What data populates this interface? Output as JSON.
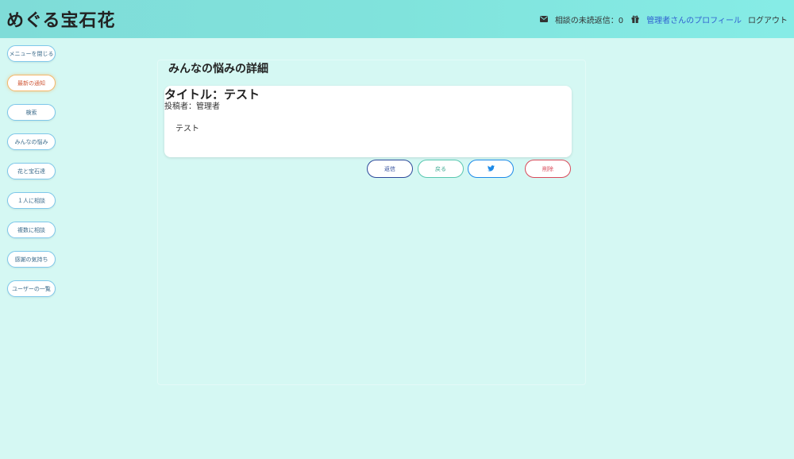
{
  "header": {
    "brand": "めぐる宝石花",
    "unread_label": "相談の未読返信：0",
    "profile_label": "管理者さんのプロフィール",
    "logout_label": "ログアウト"
  },
  "sidebar": {
    "items": [
      {
        "label": "メニューを閉じる"
      },
      {
        "label": "最新の通知"
      },
      {
        "label": "検索"
      },
      {
        "label": "みんなの悩み"
      },
      {
        "label": "花と宝石達"
      },
      {
        "label": "１人に相談"
      },
      {
        "label": "複数に相談"
      },
      {
        "label": "感謝の気持ち"
      },
      {
        "label": "ユーザーの一覧"
      }
    ]
  },
  "main": {
    "title": "みんなの悩みの詳細",
    "post": {
      "title": "タイトル：テスト",
      "author": "投稿者：管理者",
      "body": "テスト"
    },
    "actions": {
      "send": "返信",
      "back": "戻る",
      "delete": "削除"
    }
  },
  "colors": {
    "header_bg": "#80e3dc",
    "page_bg": "#d5f8f3",
    "nav_border": "#7ec7ea",
    "notify_border": "#f4b76a",
    "send": "#2d4a9a",
    "back": "#5ac7b0",
    "tweet": "#1d8ae8",
    "delete": "#d94a5a"
  },
  "icons": {
    "unread": "envelope-icon",
    "profile": "gift-icon",
    "tweet": "twitter-icon"
  }
}
